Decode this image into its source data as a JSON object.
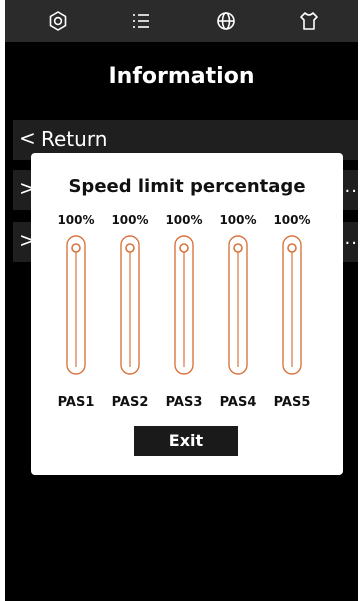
{
  "topbar": {
    "icons": [
      "gear-icon",
      "list-icon",
      "globe-icon",
      "shirt-icon"
    ]
  },
  "page_title": "Information",
  "menu": {
    "return_label": "Return",
    "row2_dots": "...",
    "row3_dots": "..."
  },
  "modal": {
    "title": "Speed limit percentage",
    "sliders": [
      {
        "label": "PAS1",
        "value_text": "100%",
        "value": 1.0
      },
      {
        "label": "PAS2",
        "value_text": "100%",
        "value": 1.0
      },
      {
        "label": "PAS3",
        "value_text": "100%",
        "value": 1.0
      },
      {
        "label": "PAS4",
        "value_text": "100%",
        "value": 1.0
      },
      {
        "label": "PAS5",
        "value_text": "100%",
        "value": 1.0
      }
    ],
    "exit_label": "Exit"
  },
  "colors": {
    "accent": "#d8743e",
    "background": "#000000",
    "topbar": "#2b2b2b"
  }
}
